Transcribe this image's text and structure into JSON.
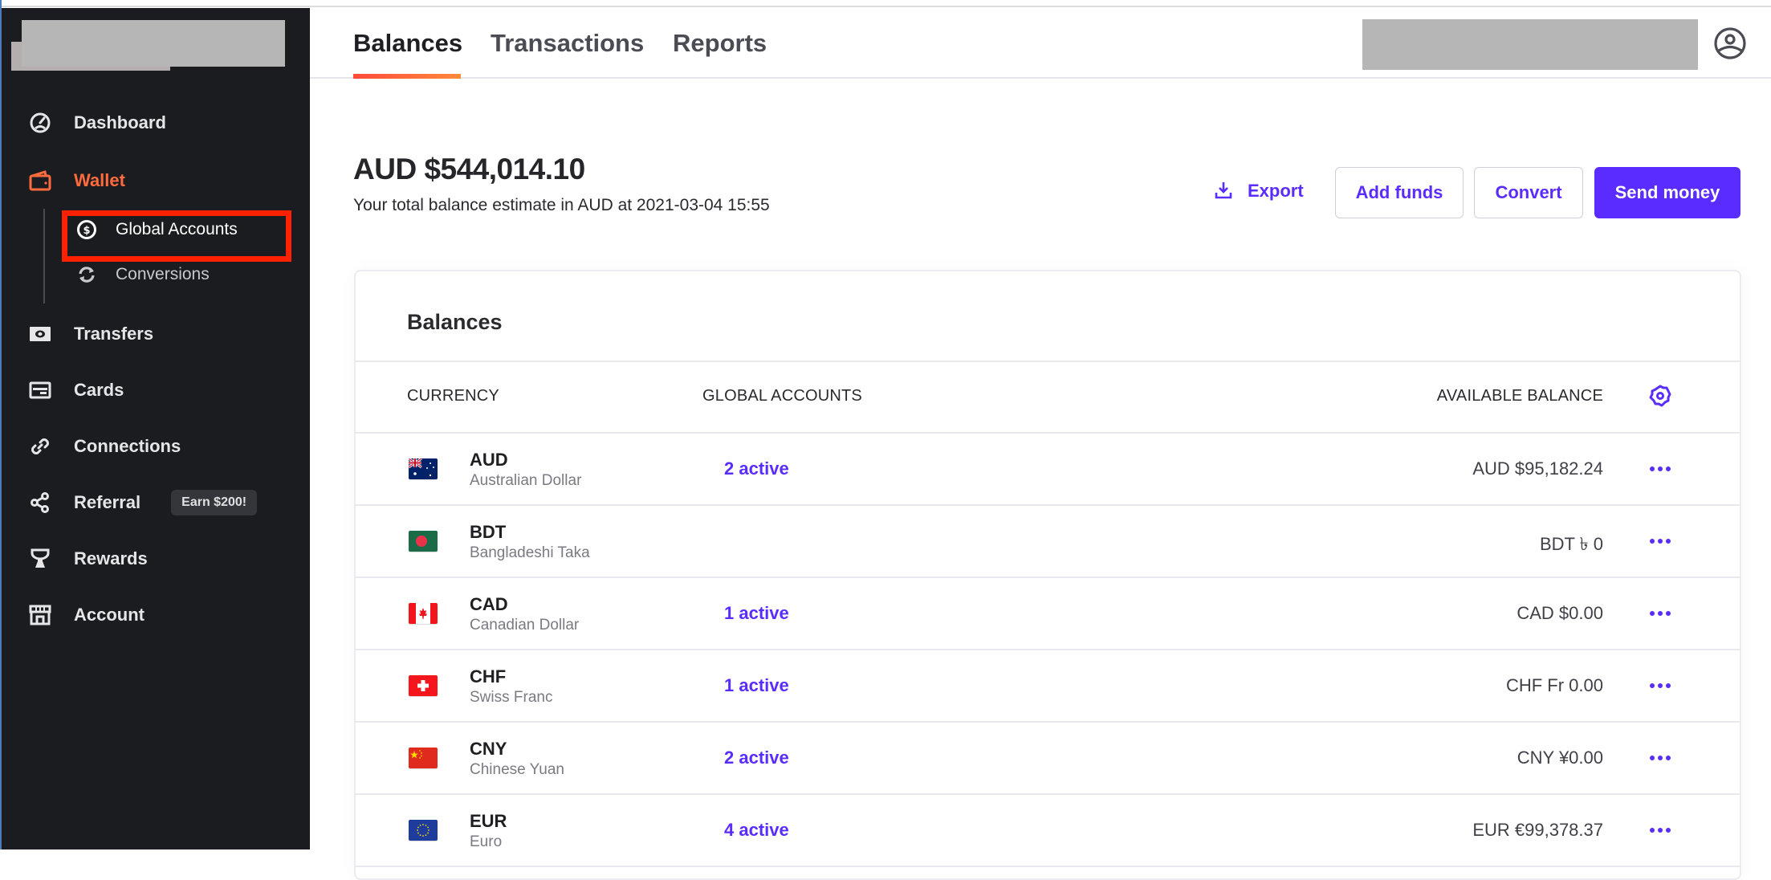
{
  "sidebar": {
    "items": [
      {
        "id": "dashboard",
        "label": "Dashboard",
        "icon": "dashboard-gauge-icon"
      },
      {
        "id": "wallet",
        "label": "Wallet",
        "icon": "wallet-icon",
        "active": true
      },
      {
        "id": "transfers",
        "label": "Transfers",
        "icon": "banknote-icon"
      },
      {
        "id": "cards",
        "label": "Cards",
        "icon": "card-icon"
      },
      {
        "id": "connections",
        "label": "Connections",
        "icon": "link-icon"
      },
      {
        "id": "referral",
        "label": "Referral",
        "icon": "share-icon",
        "badge": "Earn $200!"
      },
      {
        "id": "rewards",
        "label": "Rewards",
        "icon": "trophy-icon"
      },
      {
        "id": "account",
        "label": "Account",
        "icon": "storefront-icon"
      }
    ],
    "wallet_sub": [
      {
        "label": "Global Accounts",
        "icon": "dollar-circle-icon",
        "selected": true
      },
      {
        "label": "Conversions",
        "icon": "refresh-icon"
      }
    ]
  },
  "header": {
    "tabs": [
      {
        "label": "Balances",
        "active": true
      },
      {
        "label": "Transactions"
      },
      {
        "label": "Reports"
      }
    ]
  },
  "summary": {
    "total": "AUD $544,014.10",
    "subtitle": "Your total balance estimate in AUD at 2021-03-04 15:55"
  },
  "actions": {
    "export": "Export",
    "add_funds": "Add funds",
    "convert": "Convert",
    "send_money": "Send money"
  },
  "colors": {
    "accent": "#5a2cff",
    "active_nav": "#ff6b3d",
    "sidebar_bg": "#1b1c20",
    "highlight": "#ff2000"
  },
  "balances": {
    "title": "Balances",
    "columns": [
      "CURRENCY",
      "GLOBAL ACCOUNTS",
      "AVAILABLE BALANCE"
    ],
    "rows": [
      {
        "code": "AUD",
        "name": "Australian Dollar",
        "accounts": "2 active",
        "balance": "AUD $95,182.24",
        "flag": "au"
      },
      {
        "code": "BDT",
        "name": "Bangladeshi Taka",
        "accounts": "",
        "balance": "BDT ৳ 0",
        "flag": "bd"
      },
      {
        "code": "CAD",
        "name": "Canadian Dollar",
        "accounts": "1 active",
        "balance": "CAD $0.00",
        "flag": "ca"
      },
      {
        "code": "CHF",
        "name": "Swiss Franc",
        "accounts": "1 active",
        "balance": "CHF Fr 0.00",
        "flag": "ch"
      },
      {
        "code": "CNY",
        "name": "Chinese Yuan",
        "accounts": "2 active",
        "balance": "CNY ¥0.00",
        "flag": "cn"
      },
      {
        "code": "EUR",
        "name": "Euro",
        "accounts": "4 active",
        "balance": "EUR €99,378.37",
        "flag": "eu"
      }
    ]
  }
}
